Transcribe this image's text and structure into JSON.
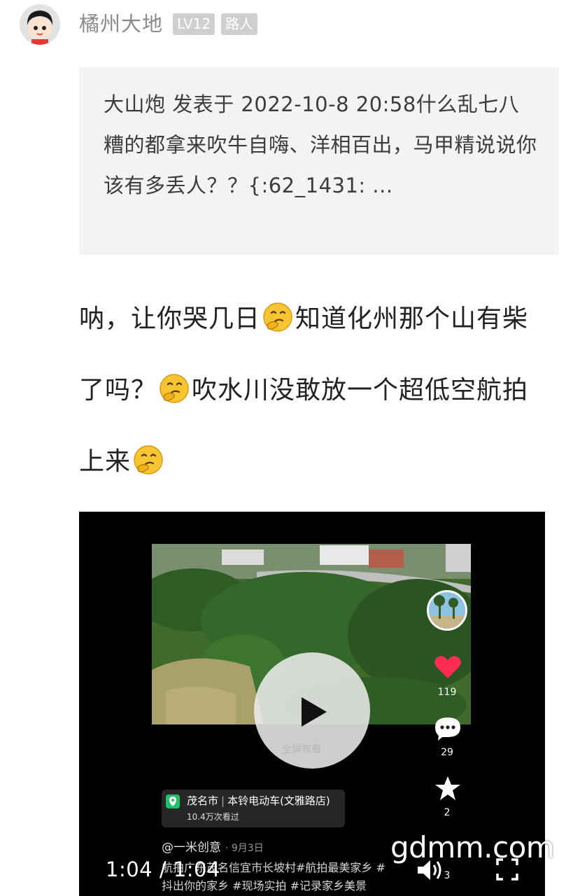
{
  "header": {
    "username": "橘州大地",
    "level_badge": "LV12",
    "role_badge": "路人"
  },
  "quote": {
    "text": "大山炮 发表于 2022-10-8 20:58什么乱七八糟的都拿来吹牛自嗨、洋相百出，马甲精说说你该有多丢人？？{:62_1431: ..."
  },
  "post": {
    "segment_1": "呐，让你哭几日",
    "segment_2": "知道化州那个山有柴了吗？",
    "segment_3": "吹水川没敢放一个超低空航拍上来",
    "emoji_name": "thinking-face-emoji"
  },
  "video": {
    "fullscreen_hint": "全屏观看",
    "likes": "119",
    "comments": "29",
    "favorites": "2",
    "shares": "3",
    "location": {
      "city": "茂名市",
      "place": "本铃电动车(文雅路店)",
      "views": "10.4万次看过"
    },
    "author": "@一米创意",
    "date": "· 9月3日",
    "description": "航拍广东茂名信宜市长坡村#航拍最美家乡 #抖出你的家乡 #现场实拍 #记录家乡美景",
    "time_display": "1:04 / 1:04"
  },
  "watermark": "gdmm.com",
  "colors": {
    "badge_bg": "#cfcfcf",
    "quote_bg": "#f3f3f3",
    "like_red": "#fe2c55",
    "location_green": "#1fbf6a"
  }
}
